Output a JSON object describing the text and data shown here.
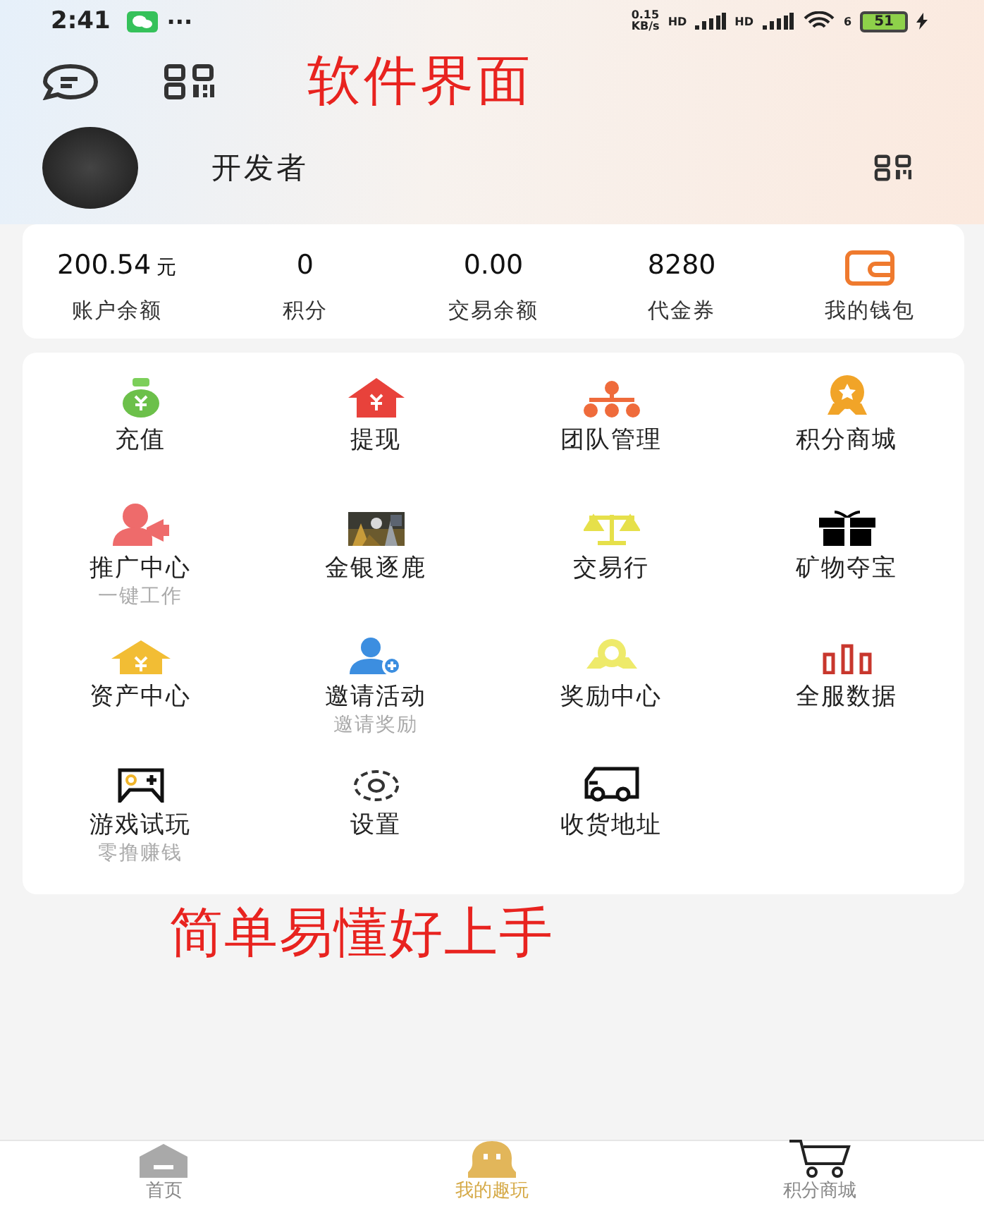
{
  "status_bar": {
    "time": "2:41",
    "more": "···",
    "net_speed": "0.15\nKB/s",
    "signal_1": "HD",
    "signal_2": "HD",
    "wifi": "6",
    "battery": "51"
  },
  "header": {
    "caption": "软件界面",
    "username": "开发者"
  },
  "stats": [
    {
      "value": "200.54",
      "unit": "元",
      "label": "账户余额"
    },
    {
      "value": "0",
      "label": "积分"
    },
    {
      "value": "0.00",
      "label": "交易余额"
    },
    {
      "value": "8280",
      "label": "代金券"
    }
  ],
  "wallet": {
    "label": "我的钱包"
  },
  "menu": [
    {
      "label": "充值"
    },
    {
      "label": "提现"
    },
    {
      "label": "团队管理"
    },
    {
      "label": "积分商城"
    },
    {
      "label": "推广中心",
      "sub": "一键工作"
    },
    {
      "label": "金银逐鹿",
      "kind": "picture"
    },
    {
      "label": "交易行"
    },
    {
      "label": "矿物夺宝"
    },
    {
      "label": "资产中心"
    },
    {
      "label": "邀请活动",
      "sub": "邀请奖励"
    },
    {
      "label": "奖励中心"
    },
    {
      "label": "全服数据"
    },
    {
      "label": "游戏试玩",
      "sub": "零撸赚钱"
    },
    {
      "label": "设置"
    },
    {
      "label": "收货地址"
    }
  ],
  "caption": "简单易懂好上手",
  "tabs": [
    {
      "label": "首页",
      "selected": false
    },
    {
      "label": "我的趣玩",
      "selected": true
    },
    {
      "label": "积分商城",
      "selected": false
    }
  ]
}
